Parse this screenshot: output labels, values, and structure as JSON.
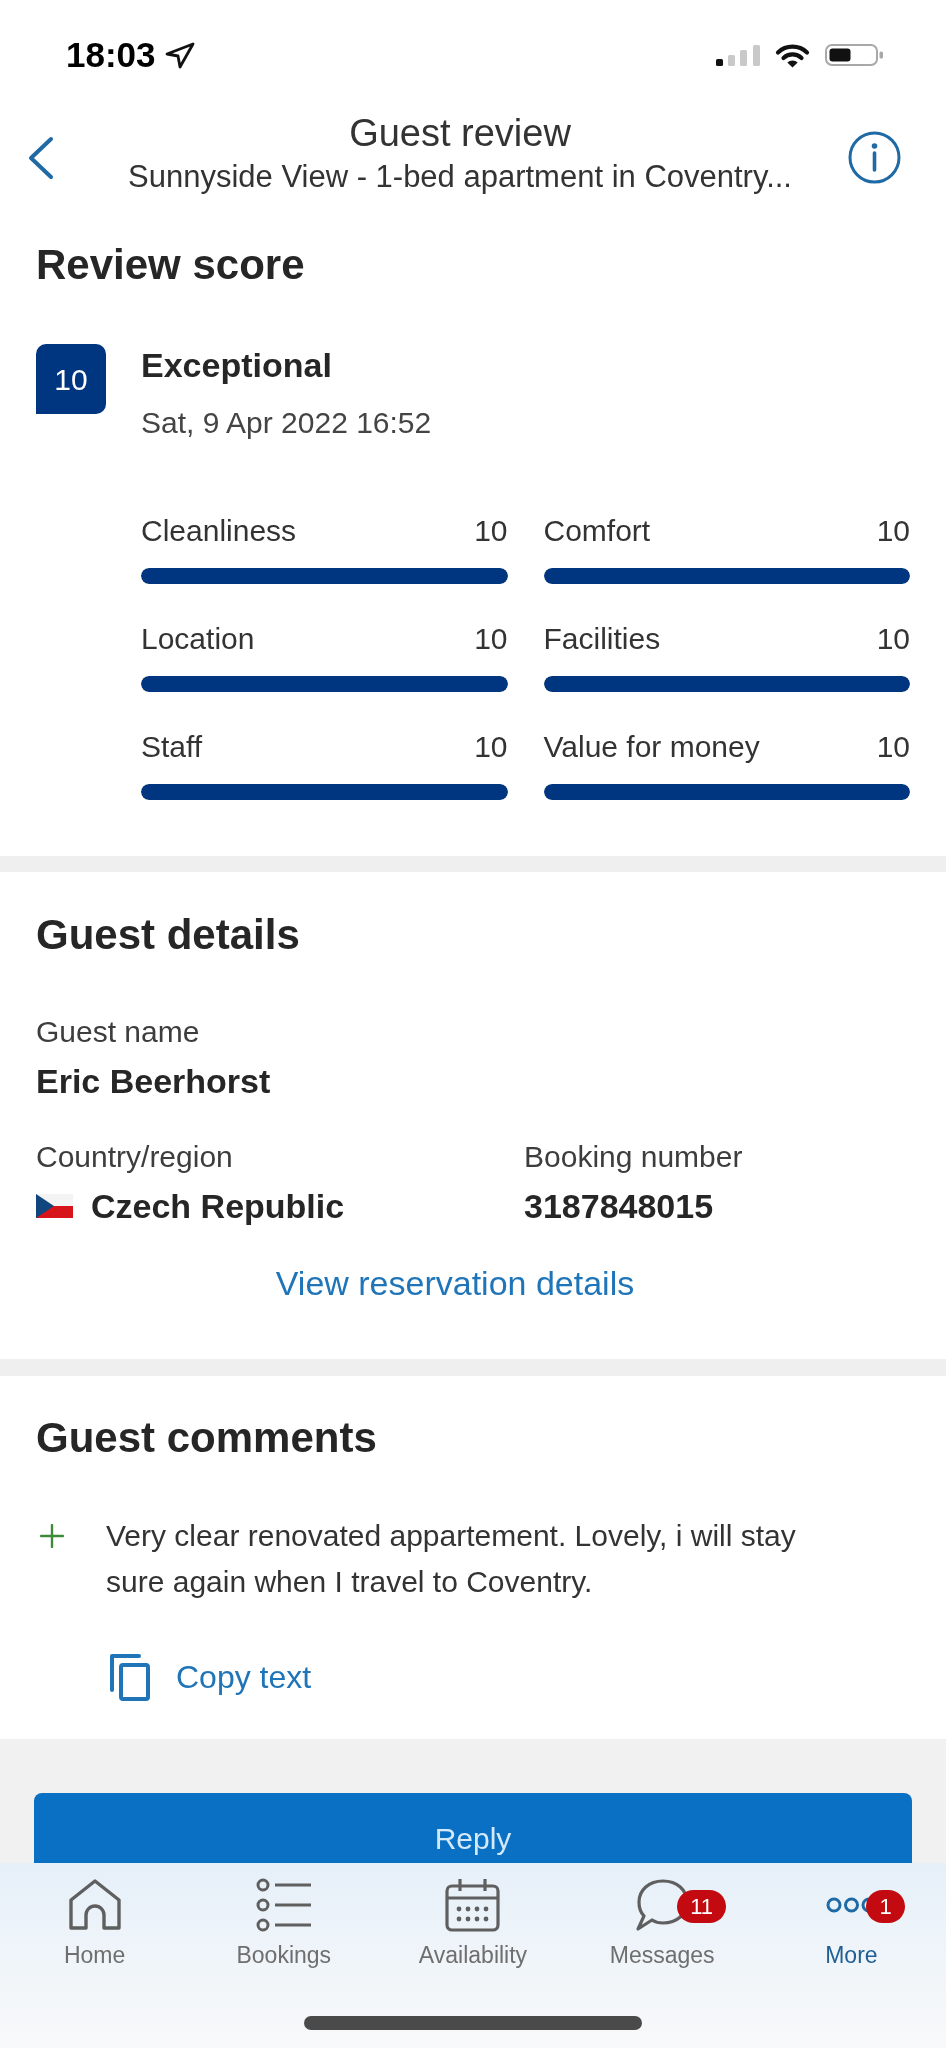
{
  "status_bar": {
    "time": "18:03"
  },
  "header": {
    "title": "Guest review",
    "subtitle": "Sunnyside View - 1-bed apartment in Coventry..."
  },
  "review_score": {
    "heading": "Review score",
    "score": "10",
    "rating": "Exceptional",
    "date": "Sat, 9 Apr 2022 16:52",
    "categories": [
      {
        "label": "Cleanliness",
        "score": "10",
        "level": 1
      },
      {
        "label": "Comfort",
        "score": "10",
        "level": 1
      },
      {
        "label": "Location",
        "score": "10",
        "level": 1
      },
      {
        "label": "Facilities",
        "score": "10",
        "level": 1
      },
      {
        "label": "Staff",
        "score": "10",
        "level": 1
      },
      {
        "label": "Value for money",
        "score": "10",
        "level": 1
      }
    ]
  },
  "guest_details": {
    "heading": "Guest details",
    "rows": [
      [
        {
          "kind": "text",
          "label": "Guest name",
          "value": "Eric Beerhorst"
        }
      ],
      [
        {
          "kind": "country",
          "label": "Country/region",
          "value": "Czech Republic"
        },
        {
          "kind": "text",
          "label": "Booking number",
          "value": "3187848015"
        }
      ]
    ],
    "link": "View reservation details"
  },
  "guest_comments": {
    "heading": "Guest comments",
    "comments": [
      {
        "kind": "positive",
        "text": "Very clear renovated appartement. Lovely, i will stay sure again when I travel to Coventry."
      }
    ],
    "copy_button": "Copy text"
  },
  "reply_button": "Reply",
  "tab_bar": [
    {
      "label": "Home",
      "selected": false
    },
    {
      "label": "Bookings",
      "selected": false
    },
    {
      "label": "Availability",
      "selected": false
    },
    {
      "label": "Messages",
      "selected": false,
      "badge": "11"
    },
    {
      "label": "More",
      "selected": true,
      "badge": "1"
    }
  ]
}
